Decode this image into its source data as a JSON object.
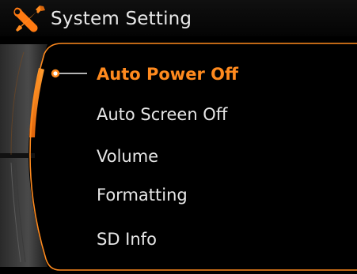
{
  "header": {
    "title": "System Setting",
    "icon": "wrench-screwdriver-icon"
  },
  "menu": {
    "selected_index": 0,
    "items": [
      {
        "label": "Auto Power Off"
      },
      {
        "label": "Auto Screen Off"
      },
      {
        "label": "Volume"
      },
      {
        "label": "Formatting"
      },
      {
        "label": "SD Info"
      }
    ]
  },
  "colors": {
    "accent": "#ff8a1e",
    "text": "#e6e6e6",
    "background": "#000000"
  }
}
